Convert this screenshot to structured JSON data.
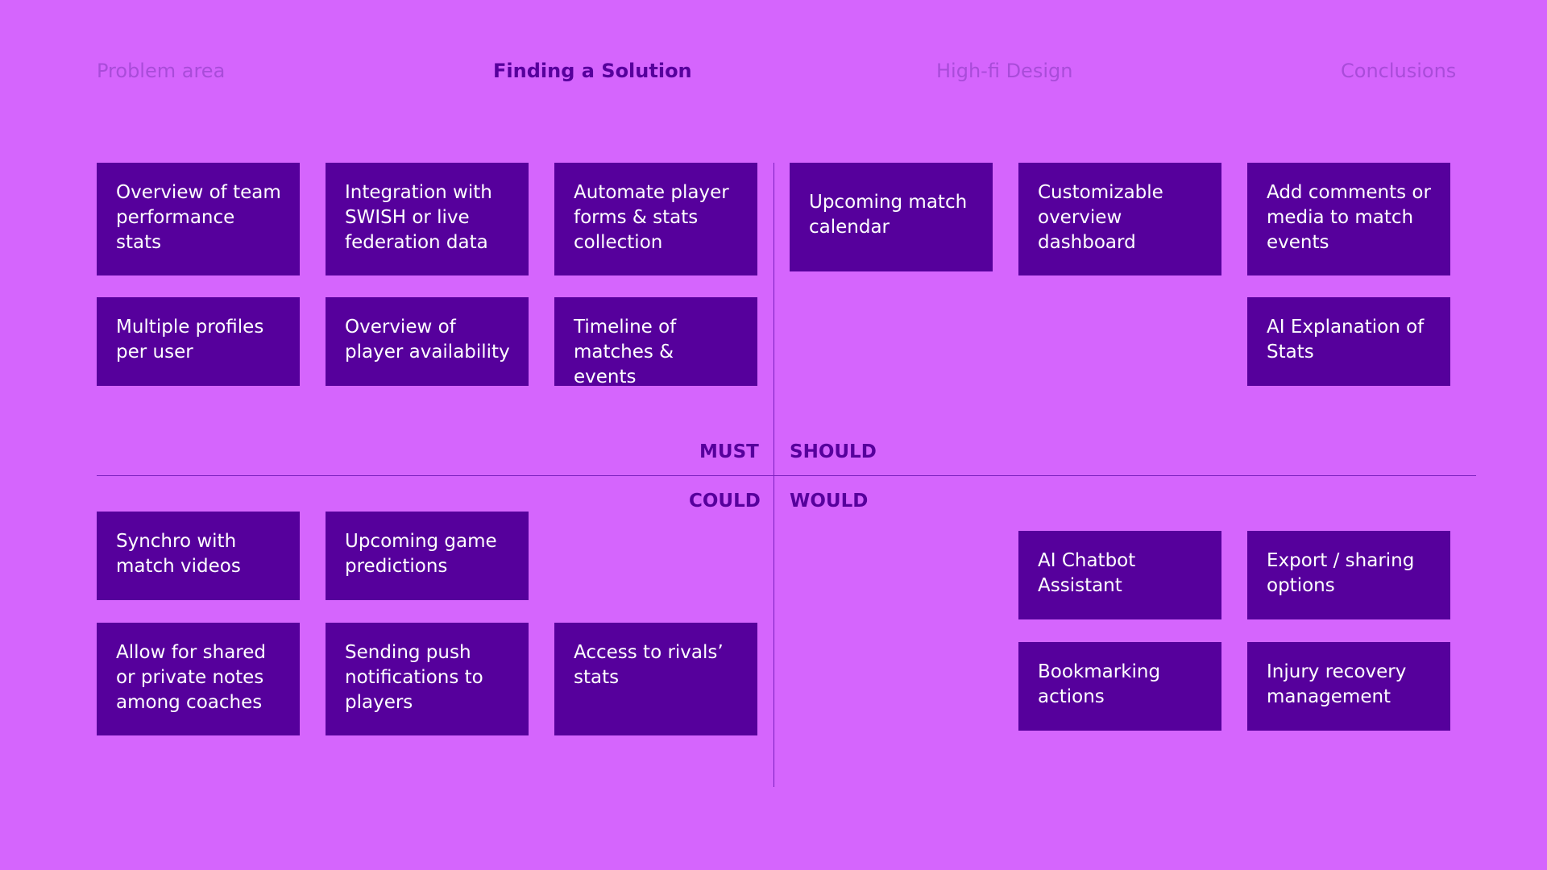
{
  "nav": {
    "items": [
      "Problem area",
      "Finding a Solution",
      "High-fi Design",
      "Conclusions"
    ]
  },
  "quadrants": {
    "must": "MUST",
    "should": "SHOULD",
    "could": "COULD",
    "would": "WOULD"
  },
  "must_cards": [
    "Overview of team performance stats",
    "Integration with SWISH or live federation data",
    "Automate player forms & stats collection",
    "Multiple profiles per user",
    "Overview of player availability",
    "Timeline of matches & events"
  ],
  "should_cards": [
    "Upcoming match calendar",
    "Customizable overview dashboard",
    "Add comments or media to match events",
    "AI Explanation of Stats"
  ],
  "could_cards": [
    "Synchro with match videos",
    "Upcoming game predictions",
    "Allow for shared or private notes among coaches",
    "Sending push notifications to players",
    "Access to rivals’ stats"
  ],
  "would_cards": [
    "AI Chatbot Assistant",
    "Export / sharing options",
    "Bookmarking actions",
    "Injury recovery management"
  ],
  "colors": {
    "background": "#d565fd",
    "card": "#56009c",
    "card_text": "#ffffff",
    "nav_active": "#56009c",
    "nav_inactive": "#a94cd9"
  }
}
